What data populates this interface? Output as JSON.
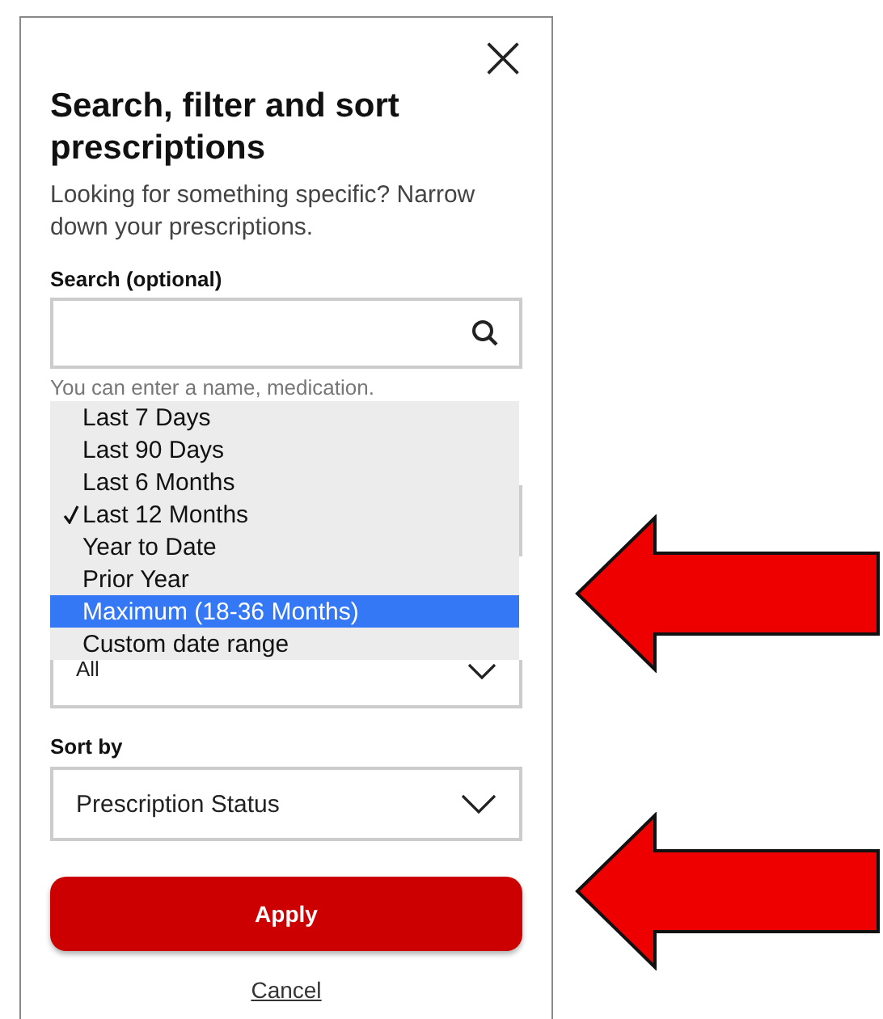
{
  "dialog": {
    "close": "×",
    "title": "Search, filter and sort prescriptions",
    "description": "Looking for something specific? Narrow down your prescriptions.",
    "search": {
      "label": "Search (optional)",
      "helper": "You can enter a name, medication."
    },
    "date_menu": {
      "options": [
        {
          "label": "Last 7 Days",
          "checked": false,
          "selected": false
        },
        {
          "label": "Last 90 Days",
          "checked": false,
          "selected": false
        },
        {
          "label": "Last 6 Months",
          "checked": false,
          "selected": false
        },
        {
          "label": "Last 12 Months",
          "checked": true,
          "selected": false
        },
        {
          "label": "Year to Date",
          "checked": false,
          "selected": false
        },
        {
          "label": "Prior Year",
          "checked": false,
          "selected": false
        },
        {
          "label": "Maximum (18-36 Months)",
          "checked": false,
          "selected": true
        },
        {
          "label": "Custom date range",
          "checked": false,
          "selected": false
        }
      ]
    },
    "filter_select": {
      "value": "All"
    },
    "sort": {
      "label": "Sort by",
      "value": "Prescription Status"
    },
    "apply": "Apply",
    "cancel": "Cancel"
  },
  "annotations": [
    {
      "kind": "arrow"
    },
    {
      "kind": "arrow"
    }
  ]
}
